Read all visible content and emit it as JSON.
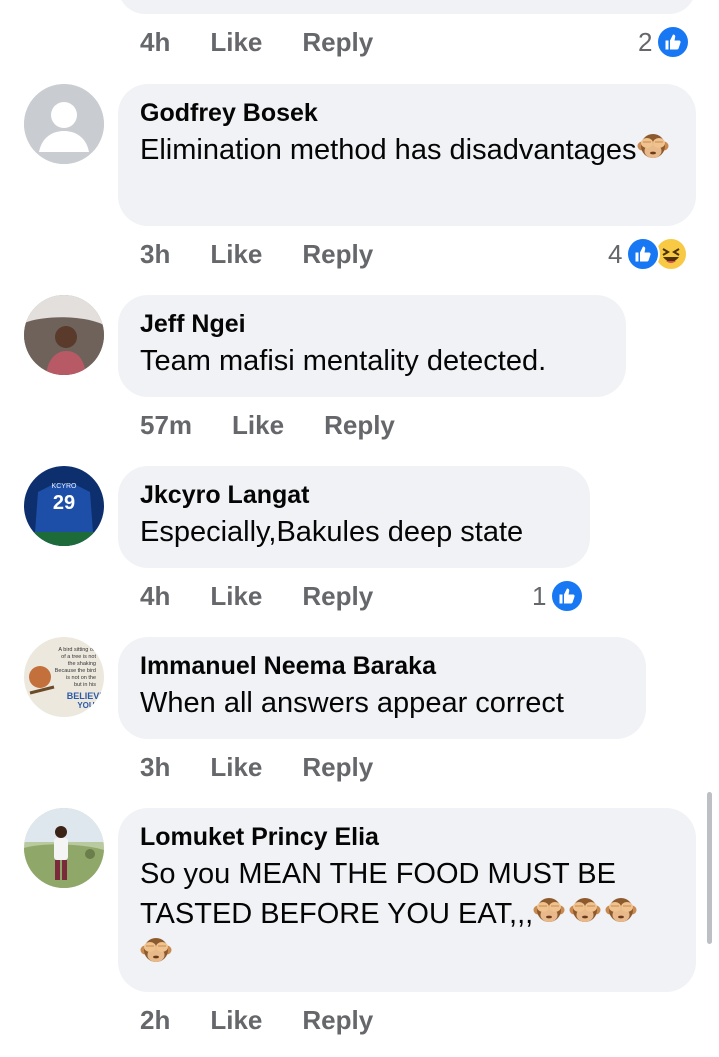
{
  "top_comment": {
    "time": "4h",
    "like": "Like",
    "reply": "Reply",
    "reaction_count": "2"
  },
  "comments": [
    {
      "author": "Godfrey Bosek",
      "text": "Elimination method has disadvantages",
      "time": "3h",
      "like": "Like",
      "reply": "Reply",
      "reaction_count": "4",
      "reactions": [
        "like-icon",
        "haha-icon"
      ]
    },
    {
      "author": "Jeff Ngei",
      "text": "Team mafisi mentality detected.",
      "time": "57m",
      "like": "Like",
      "reply": "Reply"
    },
    {
      "author": "Jkcyro Langat",
      "text": "Especially,Bakules deep state",
      "time": "4h",
      "like": "Like",
      "reply": "Reply",
      "reaction_count": "1",
      "reactions": [
        "like-icon"
      ]
    },
    {
      "author": "Immanuel Neema Baraka",
      "text": "When all answers appear correct",
      "time": "3h",
      "like": "Like",
      "reply": "Reply"
    },
    {
      "author": "Lomuket Princy Elia",
      "text": "So you MEAN THE FOOD MUST BE TASTED BEFORE YOU EAT,,,",
      "time": "2h",
      "like": "Like",
      "reply": "Reply"
    }
  ],
  "avatar_images": {
    "jersey_number": "29",
    "jersey_name": "KCYRO",
    "poster_lines": [
      "A bird sitting on",
      "of a tree is not",
      "the shaking",
      "Because the bird",
      "is not on the",
      "but in his",
      "BELIEVE",
      "YOU"
    ]
  },
  "colors": {
    "bubble": "#f0f2f5",
    "meta": "#65676b",
    "like_blue": "#1877f2",
    "haha_yellow": "#f7c945",
    "text": "#050505"
  }
}
